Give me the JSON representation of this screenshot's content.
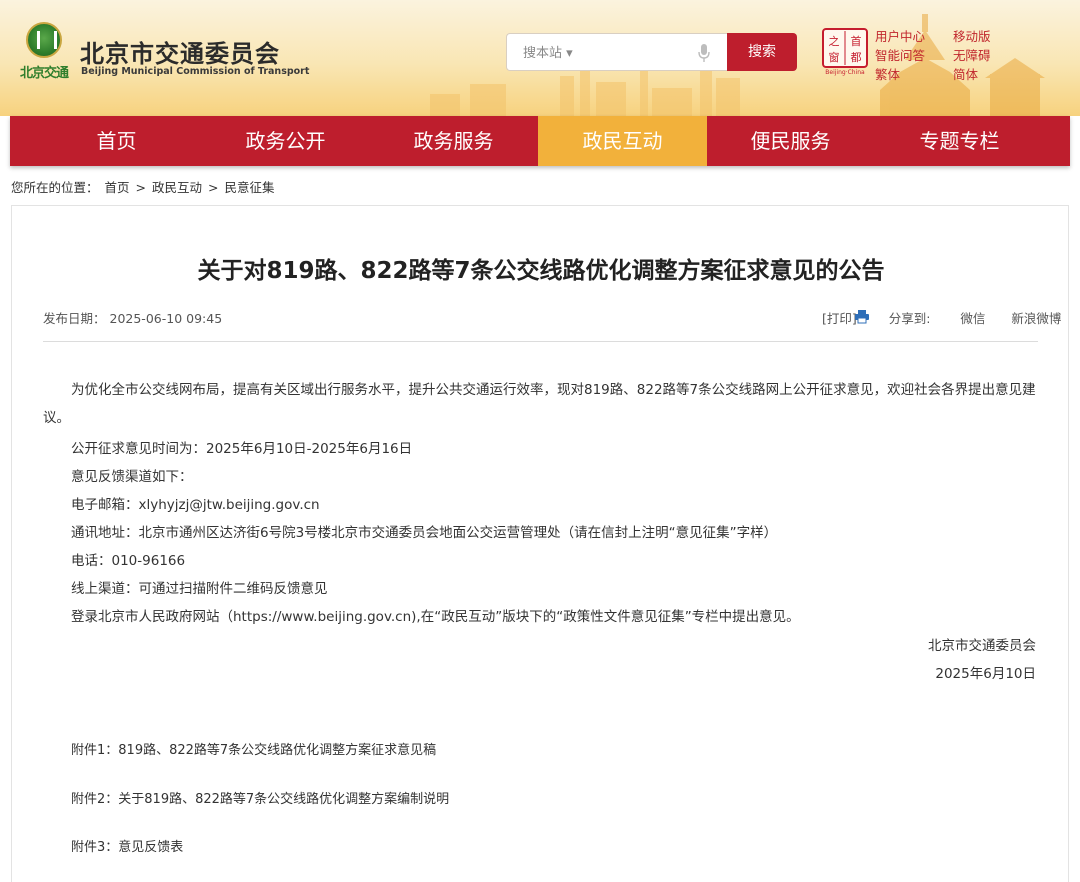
{
  "header": {
    "logo_text": "北京交通",
    "org_name_cn": "北京市交通委员会",
    "org_name_en": "Beijing Municipal Commission of Transport",
    "search_placeholder": "搜本站 ▾",
    "search_button": "搜索",
    "capital_logo_chars": [
      "之",
      "首",
      "窗",
      "都"
    ],
    "capital_logo_sub": "Beijing·China",
    "links": [
      "用户中心",
      "移动版",
      "智能问答",
      "无障碍",
      "繁体",
      "简体"
    ]
  },
  "nav": {
    "items": [
      "首页",
      "政务公开",
      "政务服务",
      "政民互动",
      "便民服务",
      "专题专栏"
    ],
    "active_index": 3
  },
  "breadcrumb": {
    "prefix": "您所在的位置：",
    "items": [
      "首页",
      "政民互动",
      "民意征集"
    ],
    "separator": ">"
  },
  "article": {
    "title": "关于对819路、822路等7条公交线路优化调整方案征求意见的公告",
    "date_label": "发布日期：",
    "date": "2025-06-10 09:45",
    "print_label": "[打印]",
    "share_label": "分享到:",
    "share_wechat": "微信",
    "share_weibo": "新浪微博",
    "paragraph1": "为优化全市公交线网布局，提高有关区域出行服务水平，提升公共交通运行效率，现对819路、822路等7条公交线路网上公开征求意见，欢迎社会各界提出意见建议。",
    "lines": [
      "公开征求意见时间为：2025年6月10日-2025年6月16日",
      "意见反馈渠道如下：",
      "电子邮箱：xlyhyjzj@jtw.beijing.gov.cn",
      "通讯地址：北京市通州区达济街6号院3号楼北京市交通委员会地面公交运营管理处（请在信封上注明“意见征集”字样）",
      "电话：010-96166",
      "线上渠道：可通过扫描附件二维码反馈意见",
      "登录北京市人民政府网站（https://www.beijing.gov.cn),在“政民互动”版块下的“政策性文件意见征集”专栏中提出意见。"
    ],
    "signature_org": "北京市交通委员会",
    "signature_date": "2025年6月10日",
    "attachments": [
      "附件1：819路、822路等7条公交线路优化调整方案征求意见稿",
      "附件2：关于819路、822路等7条公交线路优化调整方案编制说明",
      "附件3：意见反馈表"
    ]
  },
  "colors": {
    "brand_red": "#be1e2d",
    "nav_active": "#f2b13b"
  }
}
